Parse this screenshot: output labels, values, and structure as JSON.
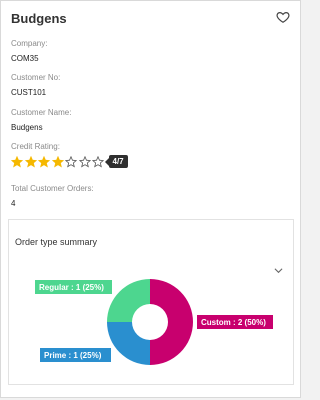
{
  "card": {
    "title": "Budgens",
    "favorite_icon": "heart-outline-icon"
  },
  "fields": {
    "company_label": "Company:",
    "company_value": "COM35",
    "customer_no_label": "Customer No:",
    "customer_no_value": "CUST101",
    "customer_name_label": "Customer Name:",
    "customer_name_value": "Budgens",
    "credit_rating_label": "Credit Rating:",
    "credit_rating_badge": "4/7",
    "credit_rating_filled": 4,
    "credit_rating_max": 7,
    "total_orders_label": "Total Customer Orders:",
    "total_orders_value": "4"
  },
  "summary": {
    "title": "Order type summary",
    "collapse_icon": "chevron-down-icon"
  },
  "colors": {
    "star_filled": "#f5b800",
    "star_empty": "#555555",
    "badge_bg": "#2f2f2f"
  },
  "chart_data": {
    "type": "pie",
    "donut": true,
    "slices": [
      {
        "name": "Custom",
        "value": 2,
        "percent": 50,
        "label": "Custom : 2 (50%)",
        "color": "#c8006e"
      },
      {
        "name": "Prime",
        "value": 1,
        "percent": 25,
        "label": "Prime : 1 (25%)",
        "color": "#2a8fcf"
      },
      {
        "name": "Regular",
        "value": 1,
        "percent": 25,
        "label": "Regular : 1 (25%)",
        "color": "#4dd68f"
      }
    ]
  }
}
